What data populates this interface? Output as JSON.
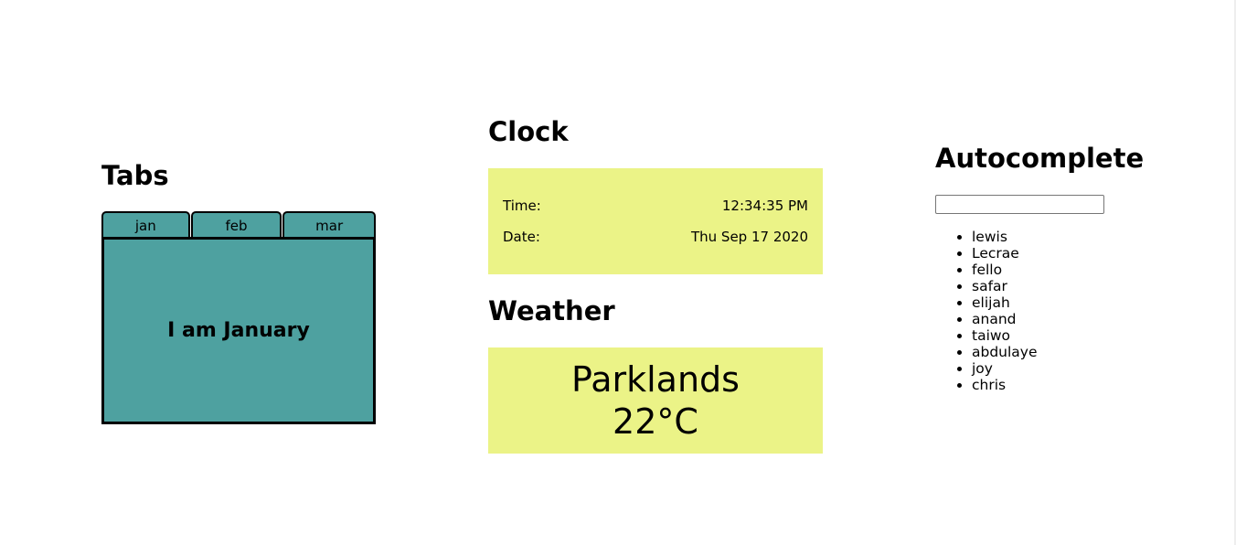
{
  "tabs": {
    "title": "Tabs",
    "items": [
      {
        "label": "jan"
      },
      {
        "label": "feb"
      },
      {
        "label": "mar"
      }
    ],
    "active_content": "I am January"
  },
  "clock": {
    "title": "Clock",
    "time_label": "Time:",
    "time_value": "12:34:35 PM",
    "date_label": "Date:",
    "date_value": "Thu Sep 17 2020"
  },
  "weather": {
    "title": "Weather",
    "location": "Parklands",
    "temperature": "22°C"
  },
  "autocomplete": {
    "title": "Autocomplete",
    "input_value": "",
    "suggestions": [
      "lewis",
      "Lecrae",
      "fello",
      "safar",
      "elijah",
      "anand",
      "taiwo",
      "abdulaye",
      "joy",
      "chris"
    ]
  },
  "colors": {
    "tab_bg": "#4ea1a0",
    "panel_yellow": "#ebf387"
  }
}
